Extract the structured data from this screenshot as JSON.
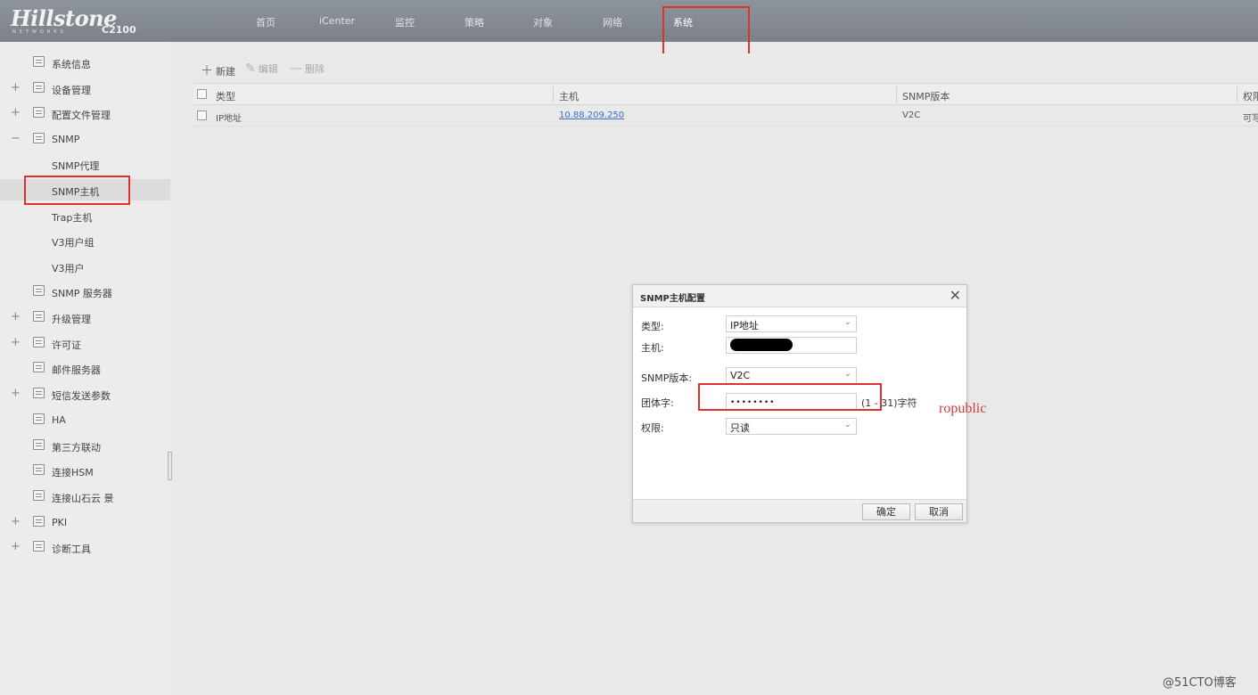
{
  "header": {
    "logo": "Hillstone",
    "logo_sub": "NETWORKS",
    "model": "C2100",
    "nav": [
      "首页",
      "iCenter",
      "监控",
      "策略",
      "对象",
      "网络",
      "系统"
    ],
    "active_nav": "系统"
  },
  "sidebar": {
    "items": [
      {
        "label": "系统信息",
        "expand": "",
        "icon": "info-icon"
      },
      {
        "label": "设备管理",
        "expand": "+",
        "icon": "device-icon"
      },
      {
        "label": "配置文件管理",
        "expand": "+",
        "icon": "config-file-icon"
      },
      {
        "label": "SNMP",
        "expand": "−",
        "icon": "snmp-icon"
      },
      {
        "label": "SNMP代理",
        "expand": "",
        "icon": ""
      },
      {
        "label": "SNMP主机",
        "expand": "",
        "icon": ""
      },
      {
        "label": "Trap主机",
        "expand": "",
        "icon": ""
      },
      {
        "label": "V3用户组",
        "expand": "",
        "icon": ""
      },
      {
        "label": "V3用户",
        "expand": "",
        "icon": ""
      },
      {
        "label": "SNMP 服务器",
        "expand": "",
        "icon": "server-icon"
      },
      {
        "label": "升级管理",
        "expand": "+",
        "icon": "upgrade-icon"
      },
      {
        "label": "许可证",
        "expand": "+",
        "icon": "license-icon"
      },
      {
        "label": "邮件服务器",
        "expand": "",
        "icon": "mail-server-icon"
      },
      {
        "label": "短信发送参数",
        "expand": "+",
        "icon": "sms-icon"
      },
      {
        "label": "HA",
        "expand": "",
        "icon": "ha-icon"
      },
      {
        "label": "第三方联动",
        "expand": "",
        "icon": "third-party-icon"
      },
      {
        "label": "连接HSM",
        "expand": "",
        "icon": "hsm-icon"
      },
      {
        "label": "连接山石云 景",
        "expand": "",
        "icon": "cloud-icon"
      },
      {
        "label": "PKI",
        "expand": "+",
        "icon": "pki-icon"
      },
      {
        "label": "诊断工具",
        "expand": "+",
        "icon": "diagnostic-icon"
      }
    ],
    "selected": "SNMP主机"
  },
  "toolbar": {
    "new_label": "新建",
    "edit_label": "编辑",
    "delete_label": "删除"
  },
  "table": {
    "columns": [
      "类型",
      "主机",
      "SNMP版本",
      "权限"
    ],
    "rows": [
      {
        "type": "IP地址",
        "host": "10.88.209.250",
        "version": "V2C",
        "permission": "可写"
      }
    ]
  },
  "dialog": {
    "title": "SNMP主机配置",
    "type_label": "类型:",
    "type_value": "IP地址",
    "host_label": "主机:",
    "version_label": "SNMP版本:",
    "version_value": "V2C",
    "community_label": "团体字:",
    "community_value": "••••••••",
    "community_hint": "(1 - 31)字符",
    "permission_label": "权限:",
    "permission_value": "只读",
    "ok_label": "确定",
    "cancel_label": "取消"
  },
  "annotation": "ropublic",
  "watermark": "@51CTO博客",
  "colors": {
    "topbar": "#838890",
    "highlight": "#e03030",
    "annotation": "#d63a3a",
    "link": "#3a6fc4"
  }
}
